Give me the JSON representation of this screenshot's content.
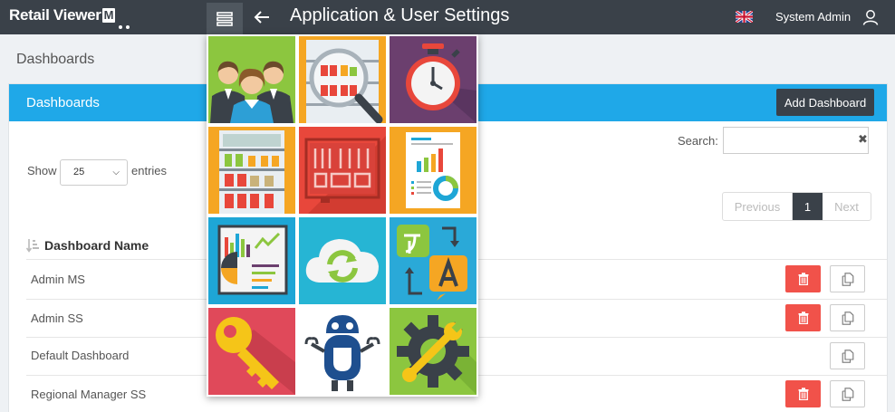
{
  "app": {
    "logo_text": "Retail Viewer",
    "logo_mark": "M",
    "title": "Application & User Settings",
    "user": "System Admin",
    "menu_icon": "menu-icon",
    "back_icon": "arrow-left-icon",
    "flag_icon": "uk-flag-icon",
    "user_icon": "user-icon"
  },
  "breadcrumb": {
    "heading": "Dashboards"
  },
  "panel": {
    "title": "Dashboards",
    "add_button": "Add Dashboard",
    "show_label": "Show",
    "entries_value": "25",
    "entries_label": "entries",
    "search_label": "Search:",
    "search_value": "",
    "pagination": {
      "previous": "Previous",
      "current": "1",
      "next": "Next"
    },
    "column_header": "Dashboard Name",
    "rows": [
      {
        "name": "Admin MS",
        "deletable": true
      },
      {
        "name": "Admin SS",
        "deletable": true
      },
      {
        "name": "Default Dashboard",
        "deletable": false
      },
      {
        "name": "Regional Manager SS",
        "deletable": true
      }
    ]
  },
  "app_grid": {
    "tiles": [
      {
        "icon": "users-icon",
        "bg": "#8cc63f"
      },
      {
        "icon": "shelf-magnifier-icon",
        "bg": "#f5a623"
      },
      {
        "icon": "stopwatch-icon",
        "bg": "#6b3f6e"
      },
      {
        "icon": "shelves-icon",
        "bg": "#f5a623"
      },
      {
        "icon": "floorplan-icon",
        "bg": "#e8473b"
      },
      {
        "icon": "report-icon",
        "bg": "#f5a623"
      },
      {
        "icon": "analytics-board-icon",
        "bg": "#1ea6d6"
      },
      {
        "icon": "cloud-sync-icon",
        "bg": "#26b5d4"
      },
      {
        "icon": "translate-icon",
        "bg": "#2aa9d8"
      },
      {
        "icon": "key-icon",
        "bg": "#e0495a"
      },
      {
        "icon": "robot-icon",
        "bg": "#ffffff"
      },
      {
        "icon": "gear-wrench-icon",
        "bg": "#8cc63f"
      }
    ]
  },
  "colors": {
    "topbar": "#3a4149",
    "accent": "#1fa8e8",
    "danger": "#f1524a"
  }
}
